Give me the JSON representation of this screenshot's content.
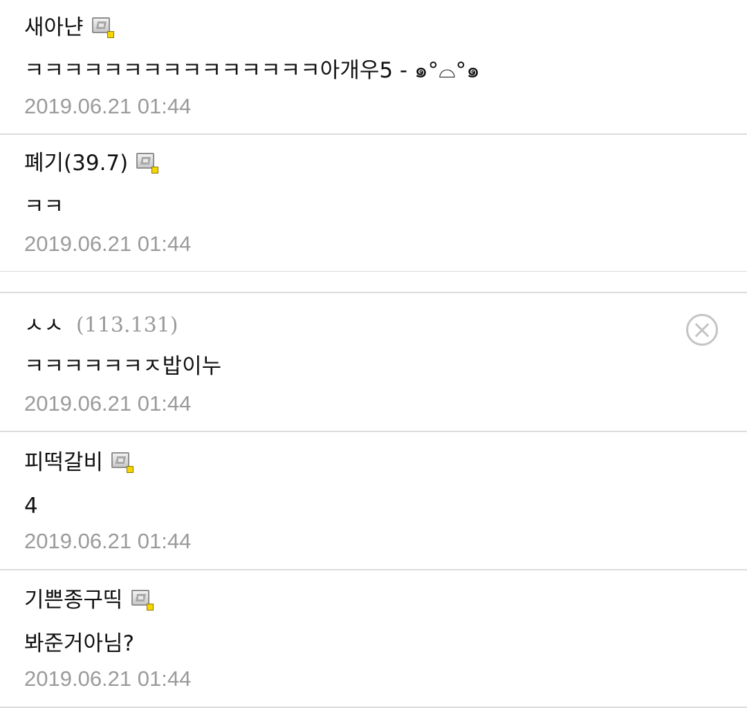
{
  "comments": [
    {
      "author": "새아냔",
      "ip": "",
      "member_icon": "member-badge-icon",
      "content": "ㅋㅋㅋㅋㅋㅋㅋㅋㅋㅋㅋㅋㅋㅋㅋ아개우5 - ๑°⌓°๑",
      "date": "2019.06.21 01:44"
    },
    {
      "author": "폐기(39.7)",
      "ip": "",
      "member_icon": "member-badge-icon",
      "content": "ㅋㅋ",
      "date": "2019.06.21 01:44"
    },
    {
      "author": "ㅅㅅ",
      "ip": "(113.131)",
      "member_icon": "",
      "delete_icon": "close-circle-icon",
      "content": "ㅋㅋㅋㅋㅋㅋㅈ밥이누",
      "date": "2019.06.21 01:44"
    },
    {
      "author": "피떡갈비",
      "ip": "",
      "member_icon": "member-badge-icon",
      "content": "4",
      "date": "2019.06.21 01:44"
    },
    {
      "author": "기쁜종구띡",
      "ip": "",
      "member_icon": "member-badge-icon",
      "content": "봐준거아님?",
      "date": "2019.06.21 01:44"
    }
  ],
  "colors": {
    "text": "#111111",
    "meta_gray": "#9a9a9a",
    "divider": "#dcdcdc",
    "badge_dot": "#f5d400"
  }
}
